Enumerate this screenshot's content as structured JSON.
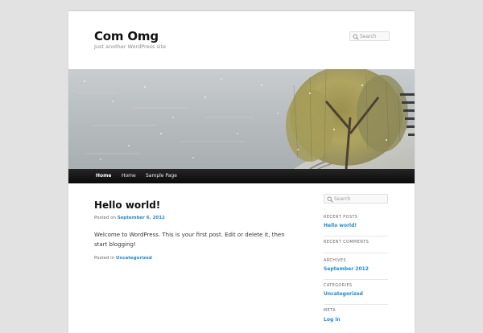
{
  "site": {
    "title": "Com Omg",
    "tagline": "Just another WordPress site"
  },
  "header_search": {
    "placeholder": "Search"
  },
  "nav": {
    "items": [
      {
        "label": "Home",
        "current": true
      },
      {
        "label": "Home",
        "current": false
      },
      {
        "label": "Sample Page",
        "current": false
      }
    ]
  },
  "post": {
    "title": "Hello world!",
    "posted_on_label": "Posted on",
    "date": "September 6, 2012",
    "body": "Welcome to WordPress. This is your first post. Edit or delete it, then start blogging!",
    "posted_in_label": "Posted in",
    "category": "Uncategorized"
  },
  "sidebar": {
    "search_placeholder": "Search",
    "widgets": [
      {
        "title": "RECENT POSTS",
        "items": [
          "Hello world!"
        ]
      },
      {
        "title": "RECENT COMMENTS",
        "items": []
      },
      {
        "title": "ARCHIVES",
        "items": [
          "September 2012"
        ]
      },
      {
        "title": "CATEGORIES",
        "items": [
          "Uncategorized"
        ]
      },
      {
        "title": "META",
        "items": [
          "Log in"
        ]
      }
    ]
  },
  "colors": {
    "link": "#1b8be0",
    "nav_bg": "#111111",
    "page_bg": "#e2e2e2"
  },
  "icons": {
    "search": "magnifier-icon"
  }
}
